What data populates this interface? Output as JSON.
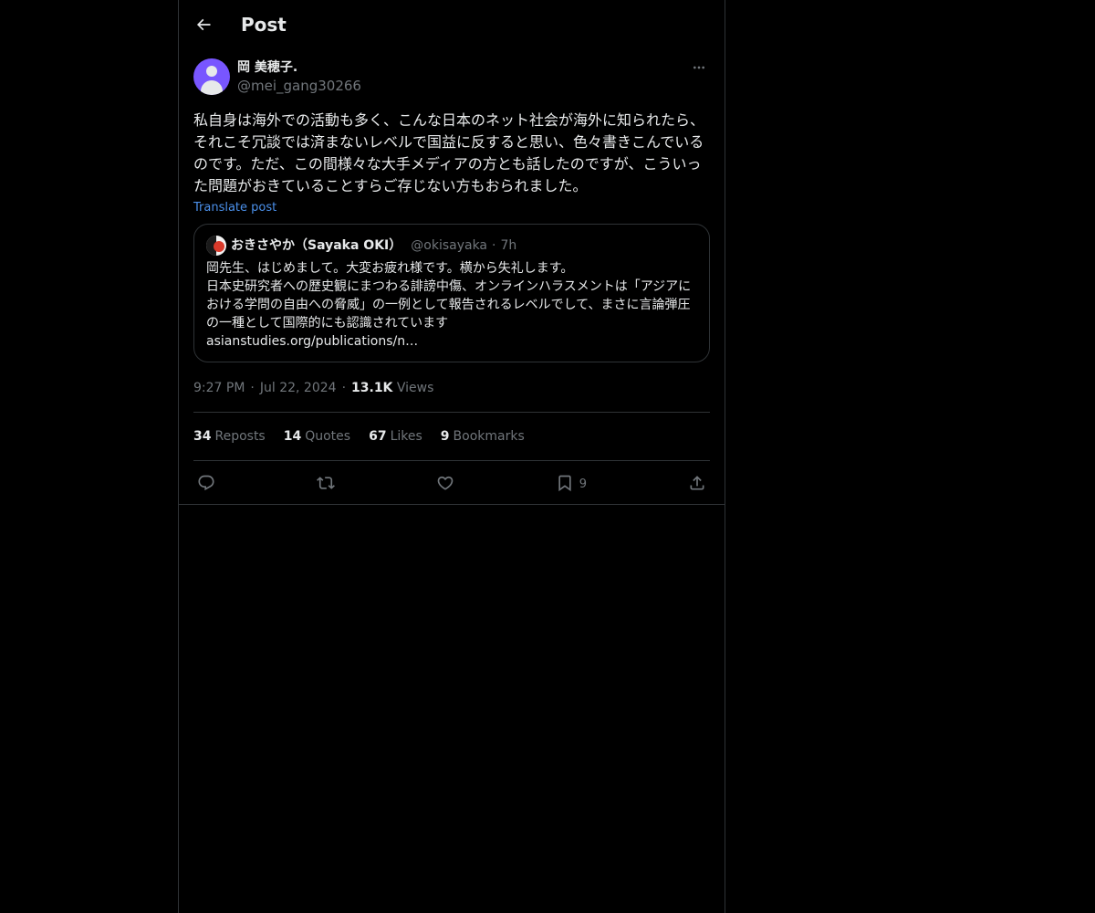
{
  "header": {
    "title": "Post"
  },
  "post": {
    "author": {
      "display_name": "岡 美穂子.",
      "handle": "@mei_gang30266"
    },
    "text": "私自身は海外での活動も多く、こんな日本のネット社会が海外に知られたら、それこそ冗談では済まないレベルで国益に反すると思い、色々書きこんでいるのです。ただ、この間様々な大手メディアの方とも話したのですが、こういった問題がおきていることすらご存じない方もおられました。",
    "translate_label": "Translate post",
    "quote": {
      "display_name": "おきさやか（Sayaka OKI）",
      "handle": "@okisayaka",
      "separator": "·",
      "time": "7h",
      "text": "岡先生、はじめまして。大変お疲れ様です。横から失礼します。\n日本史研究者への歴史観にまつわる誹謗中傷、オンラインハラスメントは「アジアにおける学問の自由への脅威」の一例として報告されるレベルでして、まさに言論弾圧の一種として国際的にも認識されています\nasianstudies.org/publications/n…"
    },
    "time": "9:27 PM",
    "date": "Jul 22, 2024",
    "separator": "·",
    "views_count": "13.1K",
    "views_label": "Views",
    "stats": [
      {
        "num": "34",
        "label": "Reposts"
      },
      {
        "num": "14",
        "label": "Quotes"
      },
      {
        "num": "67",
        "label": "Likes"
      },
      {
        "num": "9",
        "label": "Bookmarks"
      }
    ],
    "actions": {
      "bookmark_count": "9"
    }
  },
  "colors": {
    "background": "#000000",
    "text": "#e7e9ea",
    "muted": "#71767b",
    "border": "#2f3336",
    "link": "#4b90ea",
    "avatar": "#7856ff"
  },
  "icons": [
    "arrow-left-icon",
    "more-icon",
    "reply-icon",
    "repost-icon",
    "like-icon",
    "bookmark-icon",
    "share-icon"
  ]
}
